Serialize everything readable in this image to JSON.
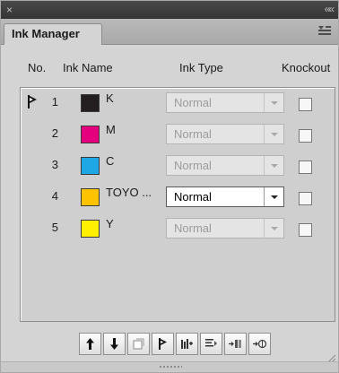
{
  "window": {
    "close_glyph": "×",
    "collapse_glyph": "««"
  },
  "tab": {
    "label": "Ink Manager"
  },
  "columns": {
    "no": "No.",
    "ink_name": "Ink Name",
    "ink_type": "Ink Type",
    "knockout": "Knockout"
  },
  "inks": [
    {
      "no": "1",
      "name": "K",
      "color": "#231f20",
      "type": "Normal",
      "active": false,
      "knockout": false,
      "process_icon": true
    },
    {
      "no": "2",
      "name": "M",
      "color": "#e5007e",
      "type": "Normal",
      "active": false,
      "knockout": false,
      "process_icon": false
    },
    {
      "no": "3",
      "name": "C",
      "color": "#1ea7e4",
      "type": "Normal",
      "active": false,
      "knockout": false,
      "process_icon": false
    },
    {
      "no": "4",
      "name": "TOYO ...",
      "color": "#fdc300",
      "type": "Normal",
      "active": true,
      "knockout": false,
      "process_icon": false
    },
    {
      "no": "5",
      "name": "Y",
      "color": "#fff000",
      "type": "Normal",
      "active": false,
      "knockout": false,
      "process_icon": false
    }
  ],
  "toolbar": {
    "buttons": [
      "move-up-icon",
      "move-down-icon",
      "new-ink-alias-icon",
      "process-ink-icon",
      "ink-mapping-icon",
      "edit-ink-icon",
      "replace-ink-icon",
      "merge-ink-icon"
    ]
  }
}
